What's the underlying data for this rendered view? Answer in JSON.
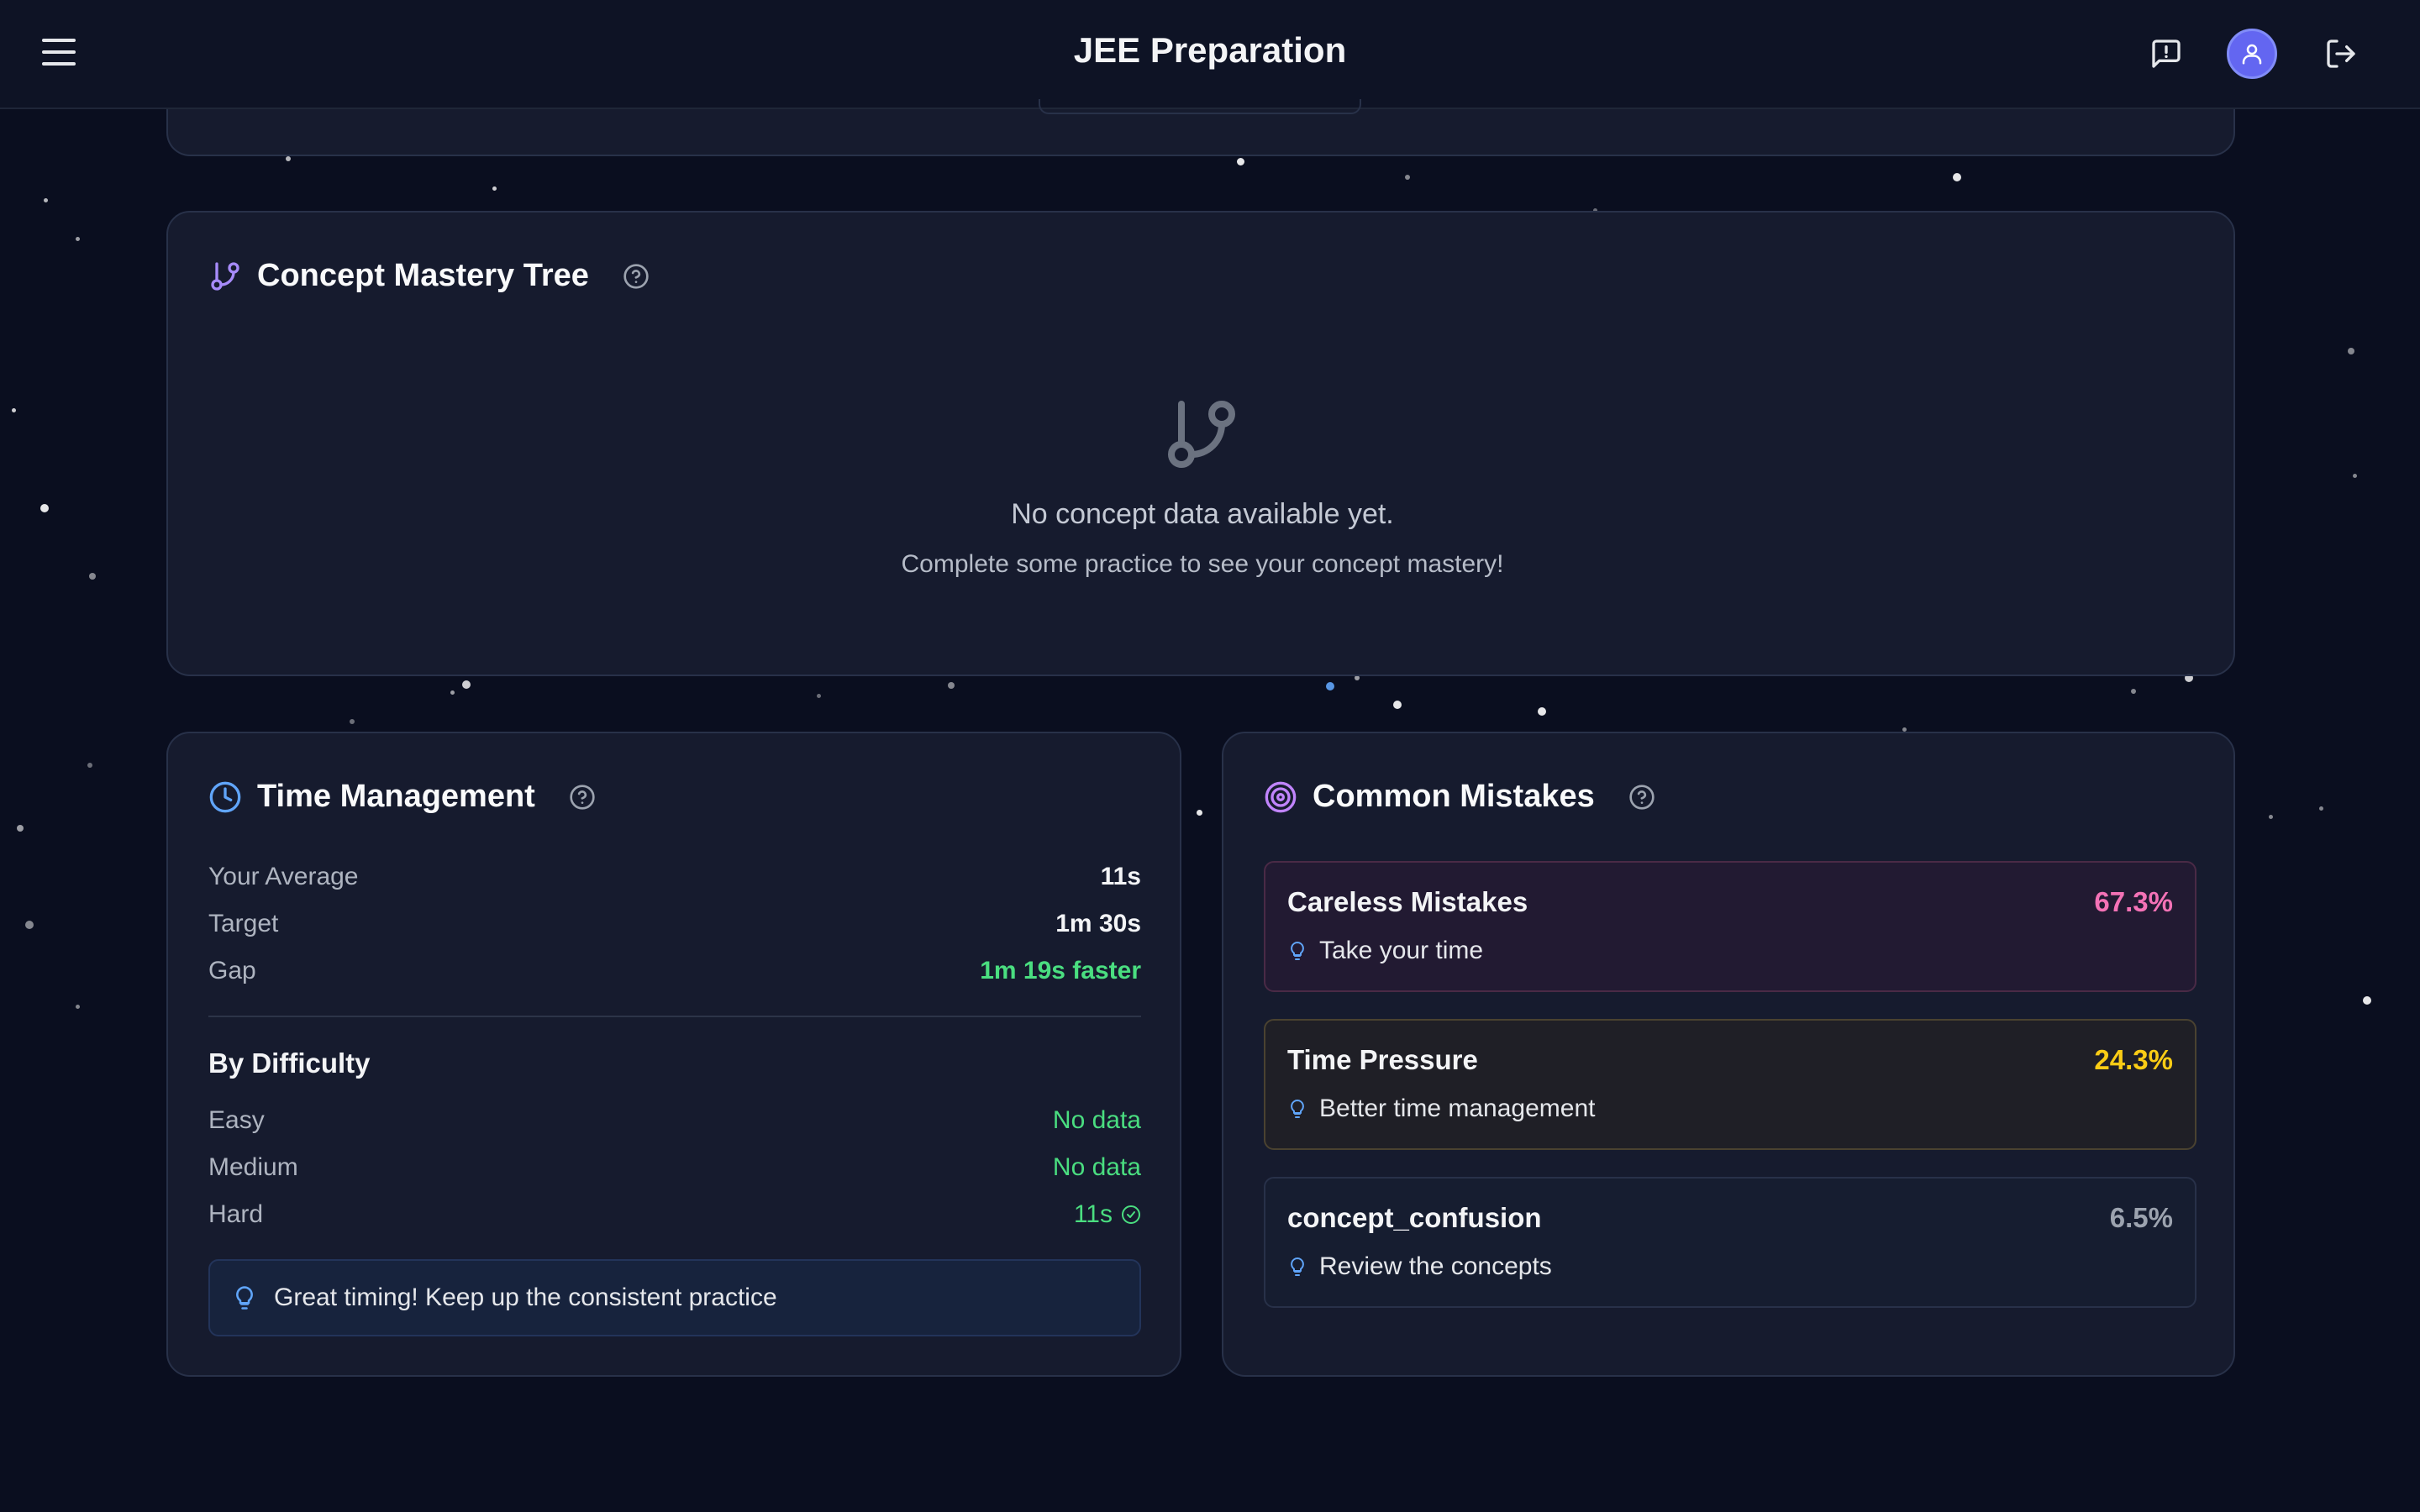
{
  "header": {
    "title": "JEE Preparation"
  },
  "concept_mastery": {
    "title": "Concept Mastery Tree",
    "empty_title": "No concept data available yet.",
    "empty_subtitle": "Complete some practice to see your concept mastery!"
  },
  "time_management": {
    "title": "Time Management",
    "stats": [
      {
        "label": "Your Average",
        "value": "11s"
      },
      {
        "label": "Target",
        "value": "1m 30s"
      },
      {
        "label": "Gap",
        "value": "1m 19s faster"
      }
    ],
    "by_difficulty_title": "By Difficulty",
    "difficulty": [
      {
        "label": "Easy",
        "value": "No data"
      },
      {
        "label": "Medium",
        "value": "No data"
      },
      {
        "label": "Hard",
        "value": "11s"
      }
    ],
    "tip": "Great timing! Keep up the consistent practice"
  },
  "common_mistakes": {
    "title": "Common Mistakes",
    "items": [
      {
        "name": "Careless Mistakes",
        "percent": "67.3%",
        "tip": "Take your time",
        "color": "#f472b6"
      },
      {
        "name": "Time Pressure",
        "percent": "24.3%",
        "tip": "Better time management",
        "color": "#facc15"
      },
      {
        "name": "concept_confusion",
        "percent": "6.5%",
        "tip": "Review the concepts",
        "color": "#9ca3af"
      }
    ]
  },
  "icons": {
    "menu": "menu-icon",
    "feedback": "message-alert-icon",
    "avatar": "user-icon",
    "logout": "logout-icon",
    "concept": "git-branch-icon",
    "time": "clock-icon",
    "mistakes": "target-icon",
    "help": "help-circle-icon",
    "tip": "lightbulb-icon",
    "check": "check-circle-icon"
  },
  "colors": {
    "background": "#0a0e1f",
    "card": "#171d30",
    "accent_purple": "#a78bfa",
    "accent_blue": "#60a5fa",
    "accent_green": "#4ade80",
    "avatar": "#6366f1"
  }
}
